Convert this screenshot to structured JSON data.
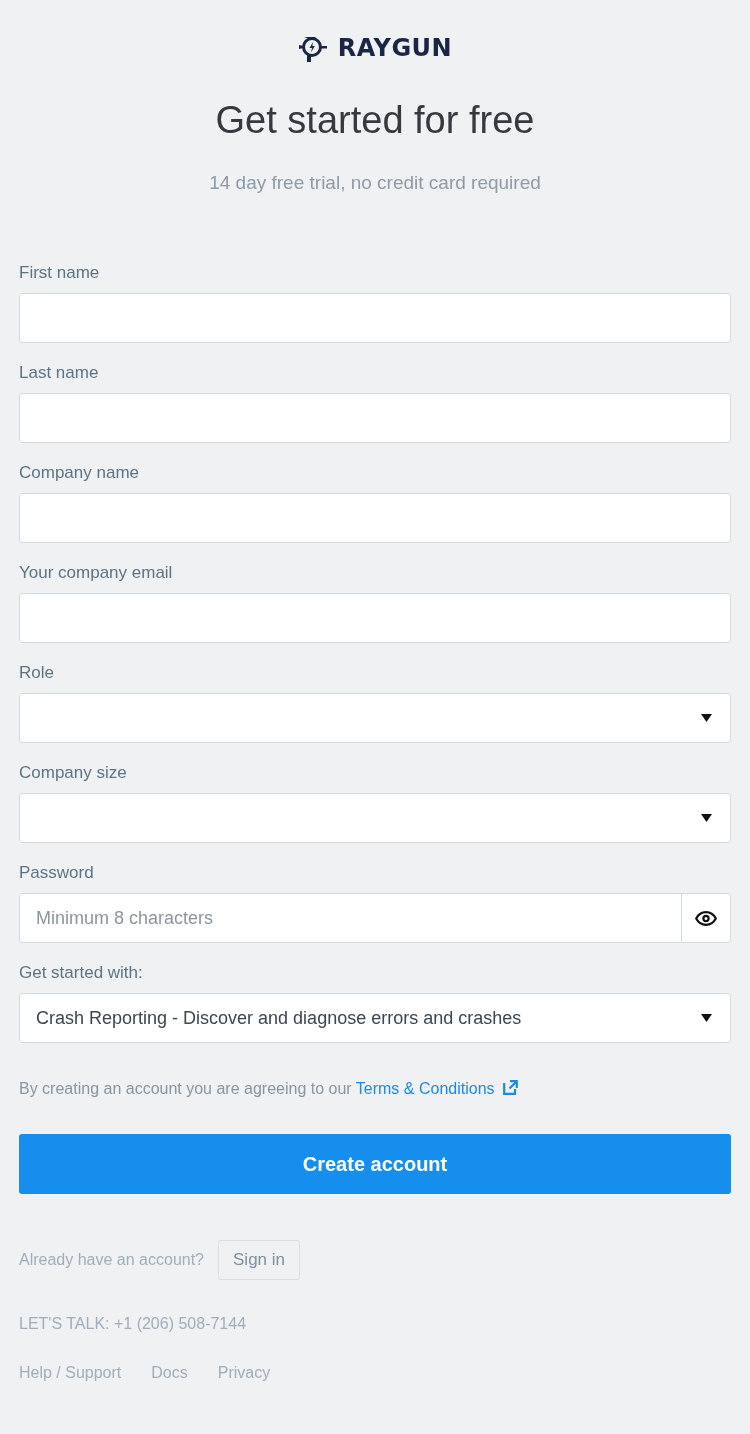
{
  "logo": {
    "wordmark": "RAYGUN"
  },
  "heading": "Get started for free",
  "subheading": "14 day free trial, no credit card required",
  "fields": [
    {
      "kind": "text",
      "label": "First name"
    },
    {
      "kind": "text",
      "label": "Last name"
    },
    {
      "kind": "text",
      "label": "Company name"
    },
    {
      "kind": "text",
      "label": "Your company email"
    },
    {
      "kind": "select",
      "label": "Role"
    },
    {
      "kind": "select",
      "label": "Company size"
    },
    {
      "kind": "password",
      "label": "Password",
      "placeholder": "Minimum 8 characters"
    },
    {
      "kind": "select",
      "label": "Get started with:",
      "value": "Crash Reporting - Discover and diagnose errors and crashes"
    }
  ],
  "terms": {
    "text": "By creating an account you are agreeing to our",
    "link": "Terms & Conditions"
  },
  "submit": "Create account",
  "signin": {
    "prompt": "Already have an account?",
    "button": "Sign in"
  },
  "contact": "LET'S TALK: +1 (206) 508-7144",
  "footer_links": [
    "Help / Support",
    "Docs",
    "Privacy"
  ]
}
